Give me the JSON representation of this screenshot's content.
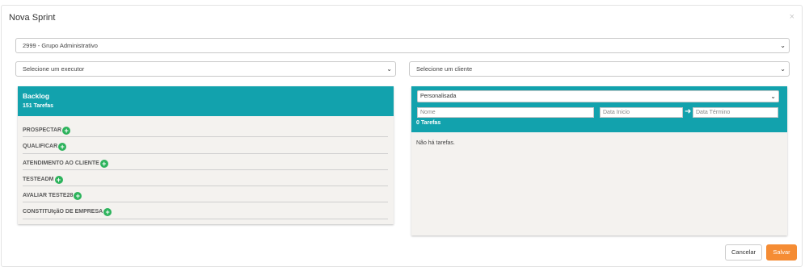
{
  "modal": {
    "title": "Nova Sprint",
    "close_icon": "×"
  },
  "group_select": {
    "value": "2999 - Grupo Administrativo",
    "caret": "⌄"
  },
  "executor_select": {
    "value": "Selecione um executor",
    "caret": "⌄"
  },
  "client_select": {
    "value": "Selecione um cliente",
    "caret": "⌄"
  },
  "backlog": {
    "title": "Backlog",
    "count": "151 Tarefas",
    "stages": [
      {
        "label": "PROSPECTAR"
      },
      {
        "label": "QUALIFICAR"
      },
      {
        "label": "ATENDIMENTO AO CLIENTE"
      },
      {
        "label": "TESTEADM"
      },
      {
        "label": "AVALIAR TESTE28"
      },
      {
        "label": "CONSTITUIçãO DE EMPRESA"
      }
    ],
    "add_icon": "+"
  },
  "sprint": {
    "period_select": {
      "value": "Personalisada",
      "caret": "⌄"
    },
    "name_placeholder": "Nome",
    "start_placeholder": "Data Inicio",
    "arrow_icon": "➜",
    "end_placeholder": "Data Término",
    "count": "0 Tarefas",
    "empty_message": "Não há tarefas."
  },
  "footer": {
    "cancel_label": "Cancelar",
    "save_label": "Salvar"
  },
  "colors": {
    "header": "#12a2ad",
    "accent": "#f58c34",
    "add": "#2db35c"
  }
}
